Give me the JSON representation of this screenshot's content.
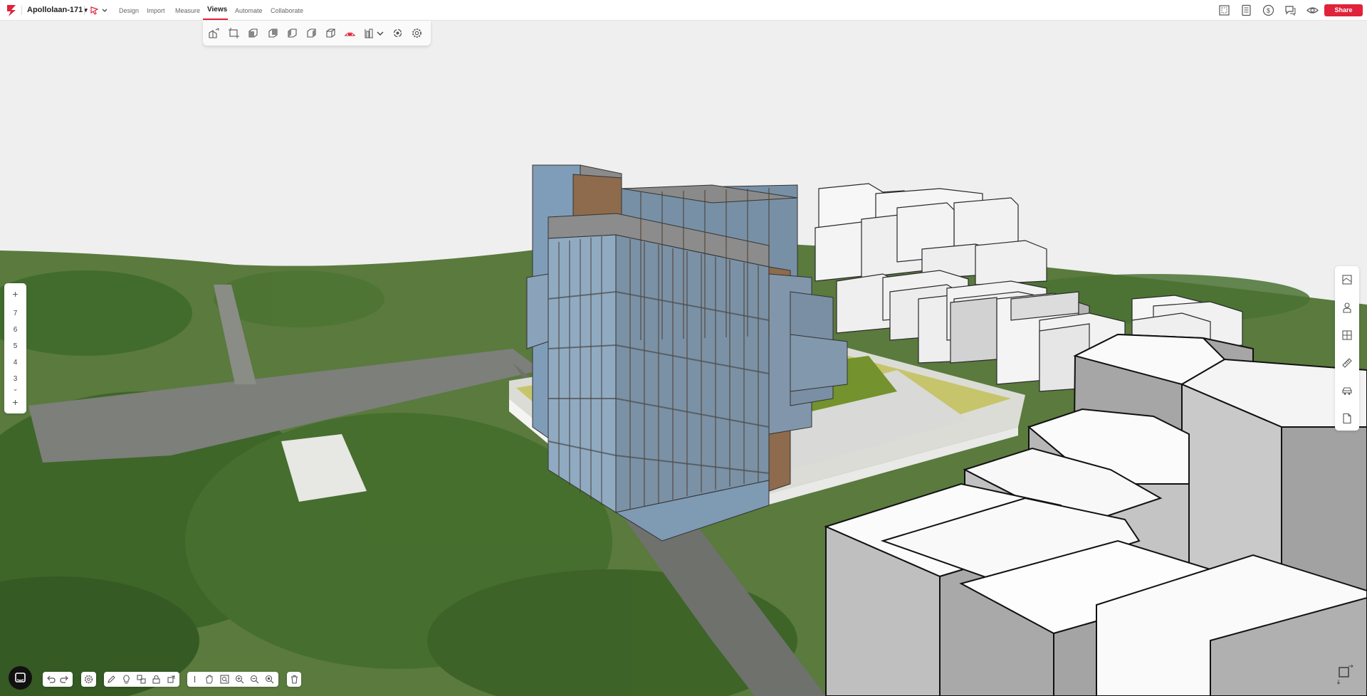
{
  "app": {
    "project_name": "Apollolaan-171",
    "brand_color": "#e0223a"
  },
  "topbar": {
    "tabs": [
      {
        "label": "Design",
        "active": false
      },
      {
        "label": "Import",
        "active": false
      },
      {
        "label": "Measure",
        "active": false
      },
      {
        "label": "Views",
        "active": true
      },
      {
        "label": "Automate",
        "active": false
      },
      {
        "label": "Collaborate",
        "active": false
      }
    ],
    "right_icons": [
      "floorplan-icon",
      "report-icon",
      "cost-dollar-icon",
      "comments-icon",
      "eye-icon"
    ],
    "share_label": "Share"
  },
  "views_toolbar": {
    "icons": [
      "perspective-view-icon",
      "top-view-icon",
      "front-view-icon",
      "back-view-icon",
      "left-view-icon",
      "right-view-icon",
      "isometric-view-icon",
      "section-view-icon",
      "layout-view-icon",
      "chevron-down-icon",
      "orbit-icon",
      "view-settings-icon"
    ]
  },
  "floor_panel": {
    "floors": [
      "7",
      "6",
      "5",
      "4",
      "3"
    ],
    "add_top": "+",
    "add_bottom": "+",
    "scroll_down": "⌄"
  },
  "right_panel": {
    "icons": [
      "layers-icon",
      "user-icon",
      "grid-icon",
      "ruler-icon",
      "car-icon",
      "document-icon"
    ]
  },
  "bottom_toolbar": {
    "history": [
      "undo-icon",
      "redo-icon"
    ],
    "settings": [
      "settings-icon"
    ],
    "draw_tools": [
      "pencil-icon",
      "lightbulb-icon",
      "shape-tool-icon",
      "lock-icon",
      "rotate-tool-icon"
    ],
    "nav_tools": [
      "cursor-icon",
      "pan-hand-icon",
      "zoom-region-icon",
      "zoom-in-icon",
      "zoom-out-icon",
      "zoom-fit-icon"
    ],
    "delete": [
      "trash-icon"
    ]
  }
}
